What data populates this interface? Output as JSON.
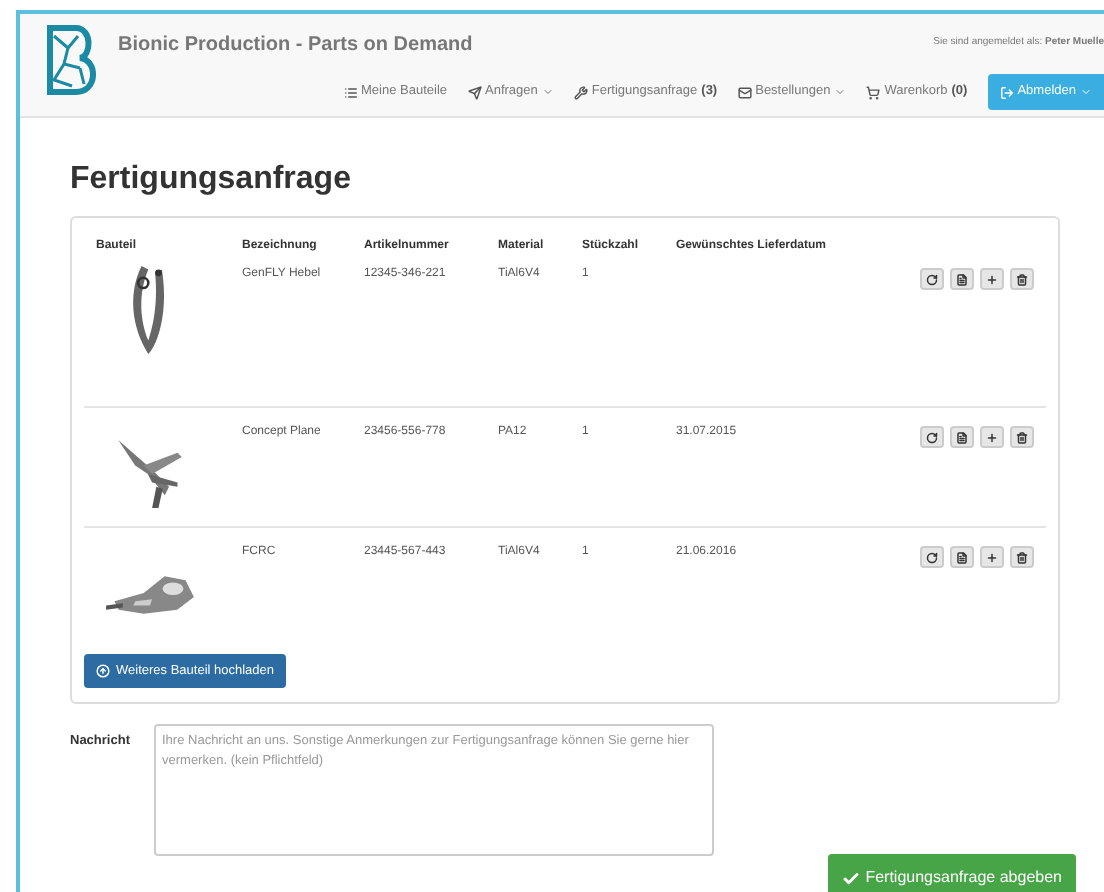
{
  "header": {
    "title": "Bionic Production - Parts on Demand",
    "login_text": "Sie sind angemeldet als:",
    "user": "Peter Muelle",
    "nav": [
      {
        "kind": "list",
        "label": "Meine Bauteile",
        "dropdown": false
      },
      {
        "kind": "send",
        "label": "Anfragen",
        "dropdown": true
      },
      {
        "kind": "wrench",
        "label": "Fertigungsanfrage",
        "count": "(3)",
        "dropdown": false
      },
      {
        "kind": "mail",
        "label": "Bestellungen",
        "dropdown": true
      },
      {
        "kind": "cart",
        "label": "Warenkorb",
        "count": "(0)",
        "dropdown": false
      }
    ],
    "logout": {
      "label": "Abmelden",
      "dropdown": true
    }
  },
  "heading": "Fertigungsanfrage",
  "table": {
    "columns": [
      "Bauteil",
      "Bezeichnung",
      "Artikelnummer",
      "Material",
      "Stückzahl",
      "Gewünschtes Lieferdatum"
    ],
    "rows": [
      {
        "name": "GenFLY Hebel",
        "article": "12345-346-221",
        "material": "TiAl6V4",
        "quantity": "1"
      },
      {
        "name": "Concept Plane",
        "article": "23456-556-778",
        "material": "PA12",
        "quantity": "1",
        "date": "31.07.2015"
      },
      {
        "name": "FCRC",
        "article": "23445-567-443",
        "material": "TiAl6V4",
        "quantity": "1",
        "date": "21.06.2016"
      }
    ]
  },
  "upload_button": "Weiteres Bauteil hochladen",
  "message": {
    "label": "Nachricht",
    "placeholder": "Ihre Nachricht an uns. Sonstige Anmerkungen zur Fertigungsanfrage können Sie gerne hier vermerken. (kein Pflichtfeld)"
  },
  "submit_button": "Fertigungsanfrage abgeben"
}
